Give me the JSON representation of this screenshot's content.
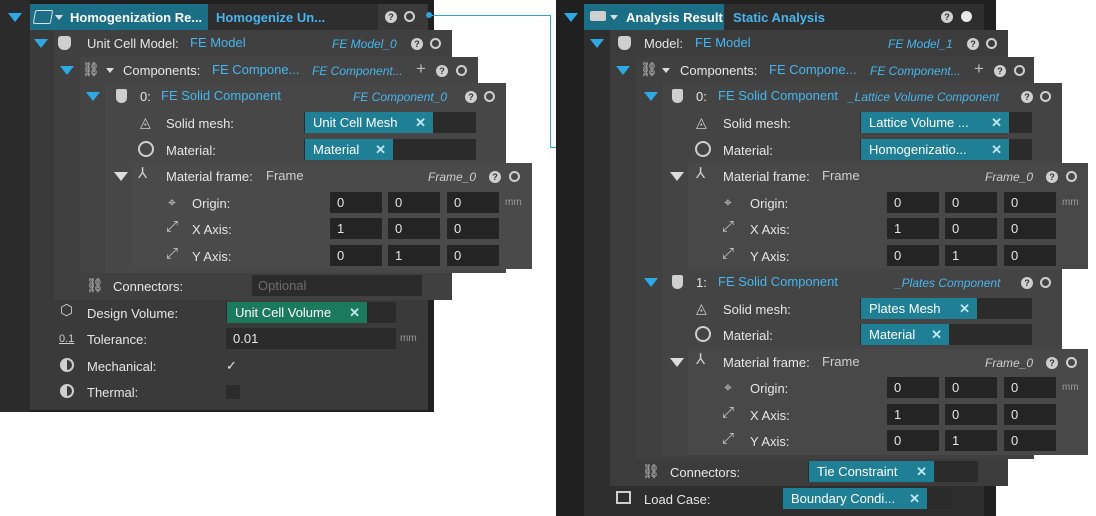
{
  "left": {
    "header": {
      "title": "Homogenization Re...",
      "action": "Homogenize Un..."
    },
    "unit_cell": {
      "label": "Unit Cell Model:",
      "value": "FE Model",
      "ref": "FE Model_0"
    },
    "components": {
      "label": "Components:",
      "value": "FE Compone...",
      "ref": "FE Component..."
    },
    "comp0": {
      "index": "0:",
      "value": "FE Solid Component",
      "ref": "FE Component_0"
    },
    "solid_mesh": {
      "label": "Solid mesh:",
      "chip": "Unit Cell Mesh"
    },
    "material": {
      "label": "Material:",
      "chip": "Material"
    },
    "frame": {
      "label": "Material frame:",
      "value": "Frame",
      "ref": "Frame_0"
    },
    "origin": {
      "label": "Origin:",
      "values": [
        "0",
        "0",
        "0"
      ],
      "unit": "mm"
    },
    "xaxis": {
      "label": "X Axis:",
      "values": [
        "1",
        "0",
        "0"
      ]
    },
    "yaxis": {
      "label": "Y Axis:",
      "values": [
        "0",
        "1",
        "0"
      ]
    },
    "connectors": {
      "label": "Connectors:",
      "placeholder": "Optional"
    },
    "design_volume": {
      "label": "Design Volume:",
      "chip": "Unit Cell Volume"
    },
    "tolerance": {
      "label": "Tolerance:",
      "value": "0.01",
      "unit": "mm",
      "icon_text": "0.1"
    },
    "mechanical": {
      "label": "Mechanical:",
      "checked": true,
      "check": "✓"
    },
    "thermal": {
      "label": "Thermal:",
      "checked": false
    }
  },
  "right": {
    "header": {
      "title": "Analysis Result",
      "action": "Static Analysis"
    },
    "model": {
      "label": "Model:",
      "value": "FE Model",
      "ref": "FE Model_1"
    },
    "components": {
      "label": "Components:",
      "value": "FE Compone...",
      "ref": "FE Component..."
    },
    "comp0": {
      "index": "0:",
      "value": "FE Solid Component",
      "ref": "_Lattice Volume Component"
    },
    "c0_mesh": {
      "label": "Solid mesh:",
      "chip": "Lattice Volume ..."
    },
    "c0_material": {
      "label": "Material:",
      "chip": "Homogenizatio..."
    },
    "c0_frame": {
      "label": "Material frame:",
      "value": "Frame",
      "ref": "Frame_0"
    },
    "c0_origin": {
      "label": "Origin:",
      "values": [
        "0",
        "0",
        "0"
      ],
      "unit": "mm"
    },
    "c0_xaxis": {
      "label": "X Axis:",
      "values": [
        "1",
        "0",
        "0"
      ]
    },
    "c0_yaxis": {
      "label": "Y Axis:",
      "values": [
        "0",
        "1",
        "0"
      ]
    },
    "comp1": {
      "index": "1:",
      "value": "FE Solid Component",
      "ref": "_Plates Component"
    },
    "c1_mesh": {
      "label": "Solid mesh:",
      "chip": "Plates Mesh"
    },
    "c1_material": {
      "label": "Material:",
      "chip": "Material"
    },
    "c1_frame": {
      "label": "Material frame:",
      "value": "Frame",
      "ref": "Frame_0"
    },
    "c1_origin": {
      "label": "Origin:",
      "values": [
        "0",
        "0",
        "0"
      ],
      "unit": "mm"
    },
    "c1_xaxis": {
      "label": "X Axis:",
      "values": [
        "1",
        "0",
        "0"
      ]
    },
    "c1_yaxis": {
      "label": "Y Axis:",
      "values": [
        "0",
        "1",
        "0"
      ]
    },
    "connectors": {
      "label": "Connectors:",
      "chip": "Tie Constraint"
    },
    "load_case": {
      "label": "Load Case:",
      "chip": "Boundary Condi..."
    }
  },
  "colors": {
    "accent": "#2fa8e6",
    "chip_blue": "#1f7f95",
    "chip_green": "#1b7a5c",
    "panel": "#3a3a3a"
  },
  "icons": [
    "homogenize-icon",
    "fe-model-icon",
    "components-icon",
    "solid-component-icon",
    "mesh-icon",
    "material-icon",
    "frame-axes-icon",
    "origin-icon",
    "axis-icon",
    "connectors-icon",
    "cube-icon",
    "tolerance-icon",
    "half-circle-icon",
    "analysis-icon",
    "load-case-icon",
    "help-icon",
    "close-icon",
    "plus-icon"
  ]
}
